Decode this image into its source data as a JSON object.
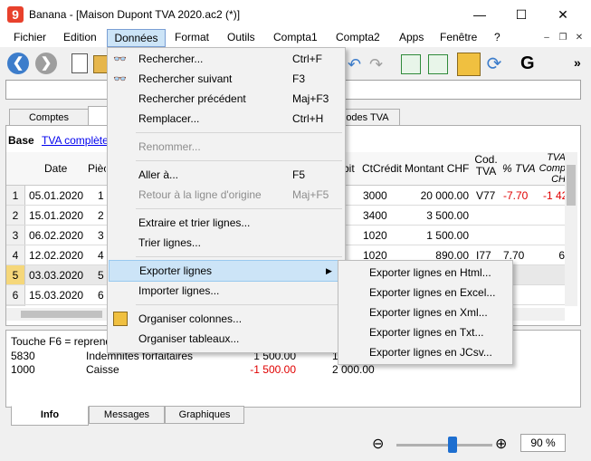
{
  "window": {
    "app_name": "Banana",
    "title": "Banana - [Maison Dupont TVA 2020.ac2 (*)]",
    "minimize": "—",
    "maximize": "☐",
    "close": "✕"
  },
  "menubar": {
    "items": [
      "Fichier",
      "Edition",
      "Données",
      "Format",
      "Outils",
      "Compta1",
      "Compta2",
      "Apps",
      "Fenêtre",
      "?"
    ],
    "active": "Données",
    "mdi_minimize": "–",
    "mdi_restore": "❐",
    "mdi_close": "✕"
  },
  "toolbar": {
    "back_icon": "back-arrow-icon",
    "forward_icon": "forward-arrow-icon",
    "bold_label": "G",
    "overflow_label": "»"
  },
  "tabs": [
    "Comptes",
    "Codes TVA"
  ],
  "view": {
    "base_label": "Base",
    "tva_link": "TVA complète"
  },
  "table": {
    "headers": [
      "Date",
      "Pièce",
      "bit",
      "CtCrédit",
      "Montant CHF",
      "Cod. TVA",
      "% TVA",
      "TVA Comp CH"
    ],
    "rows": [
      {
        "n": "1",
        "date": "05.01.2020",
        "piece": "1",
        "debit": "0",
        "credit": "3000",
        "amount": "20 000.00",
        "code": "V77",
        "pct": "-7.70",
        "tva": "-1 42"
      },
      {
        "n": "2",
        "date": "15.01.2020",
        "piece": "2",
        "debit": "0",
        "credit": "3400",
        "amount": "3 500.00",
        "code": "",
        "pct": "",
        "tva": ""
      },
      {
        "n": "3",
        "date": "06.02.2020",
        "piece": "3",
        "debit": "0",
        "credit": "1020",
        "amount": "1 500.00",
        "code": "",
        "pct": "",
        "tva": ""
      },
      {
        "n": "4",
        "date": "12.02.2020",
        "piece": "4",
        "debit": "0",
        "credit": "1020",
        "amount": "890.00",
        "code": "I77",
        "pct": "7.70",
        "tva": "6"
      },
      {
        "n": "5",
        "date": "03.03.2020",
        "piece": "5",
        "debit": "",
        "credit": "",
        "amount": "",
        "code": "",
        "pct": "",
        "tva": ""
      },
      {
        "n": "6",
        "date": "15.03.2020",
        "piece": "6",
        "debit": "",
        "credit": "",
        "amount": "",
        "code": "",
        "pct": "",
        "tva": ""
      }
    ]
  },
  "data_menu": {
    "items": [
      {
        "label": "Rechercher...",
        "shortcut": "Ctrl+F",
        "icon": "binoculars-icon"
      },
      {
        "label": "Rechercher suivant",
        "shortcut": "F3",
        "icon": "binoculars-next-icon"
      },
      {
        "label": "Rechercher précédent",
        "shortcut": "Maj+F3"
      },
      {
        "label": "Remplacer...",
        "shortcut": "Ctrl+H"
      },
      {
        "label": "Renommer...",
        "shortcut": "",
        "disabled": true
      },
      {
        "label": "Aller à...",
        "shortcut": "F5"
      },
      {
        "label": "Retour à la ligne d'origine",
        "shortcut": "Maj+F5",
        "disabled": true
      },
      {
        "label": "Extraire et trier lignes...",
        "shortcut": ""
      },
      {
        "label": "Trier lignes...",
        "shortcut": ""
      },
      {
        "label": "Exporter lignes",
        "shortcut": "",
        "submenu": true
      },
      {
        "label": "Importer lignes...",
        "shortcut": ""
      },
      {
        "label": "Organiser colonnes...",
        "shortcut": "",
        "icon": "ruler-pencil-icon"
      },
      {
        "label": "Organiser tableaux...",
        "shortcut": ""
      }
    ],
    "submenu_arrow": "▶"
  },
  "export_submenu": {
    "items": [
      "Exporter lignes en Html...",
      "Exporter lignes en Excel...",
      "Exporter lignes en Xml...",
      "Exporter lignes en Txt...",
      "Exporter lignes en JCsv..."
    ]
  },
  "info_panel": {
    "hint": "Touche F6 = reprendre",
    "lines": [
      {
        "account": "5830",
        "desc": "Indemnités forfaitaires",
        "amount": "1 500.00",
        "balance": "1"
      },
      {
        "account": "1000",
        "desc": "Caisse",
        "amount": "-1 500.00",
        "balance": "2 000.00"
      }
    ]
  },
  "bottom_tabs": [
    "Info",
    "Messages",
    "Graphiques"
  ],
  "zoom": {
    "value": "90 %",
    "level": 0.62
  },
  "colors": {
    "accent": "#cce4f7",
    "negative": "#e00000",
    "link": "#0000ee"
  }
}
